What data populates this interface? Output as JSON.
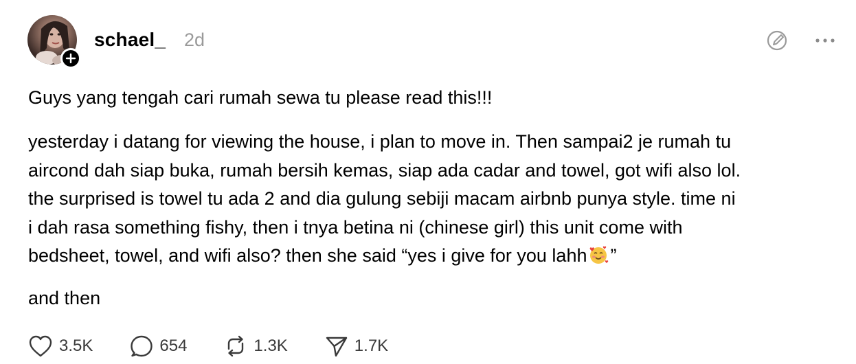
{
  "post": {
    "author": {
      "username": "schael_",
      "time": "2d"
    },
    "heading": "Guys yang tengah cari rumah sewa tu please read this!!!",
    "body_lines": [
      "yesterday i datang for viewing the house, i plan to move in. Then sampai2 je rumah tu",
      "aircond dah siap buka, rumah bersih kemas, siap ada cadar and towel, got wifi also lol.",
      "the surprised is towel tu ada 2 and dia gulung sebiji macam airbnb punya style. time ni",
      "i dah rasa something fishy, then i tnya betina ni (chinese girl) this unit come with"
    ],
    "last_line_before_emoji": "bedsheet, towel, and wifi also? then she said “yes i give for you lahh",
    "last_line_after_emoji": "”",
    "tail": "and then",
    "emoji_icon": "smiling-face-with-hearts-emoji",
    "stats": {
      "likes": "3.5K",
      "replies": "654",
      "reposts": "1.3K",
      "shares": "1.7K"
    }
  },
  "icons": {
    "follow": "plus-icon",
    "edit": "edit-pen-circle-icon",
    "more": "more-horizontal-icon",
    "like": "heart-icon",
    "reply": "comment-bubble-icon",
    "repost": "repost-icon",
    "share": "send-icon"
  },
  "colors": {
    "text": "#000000",
    "muted": "#9a9a9a",
    "icon": "#3a3a3a",
    "badge": "#000000"
  }
}
